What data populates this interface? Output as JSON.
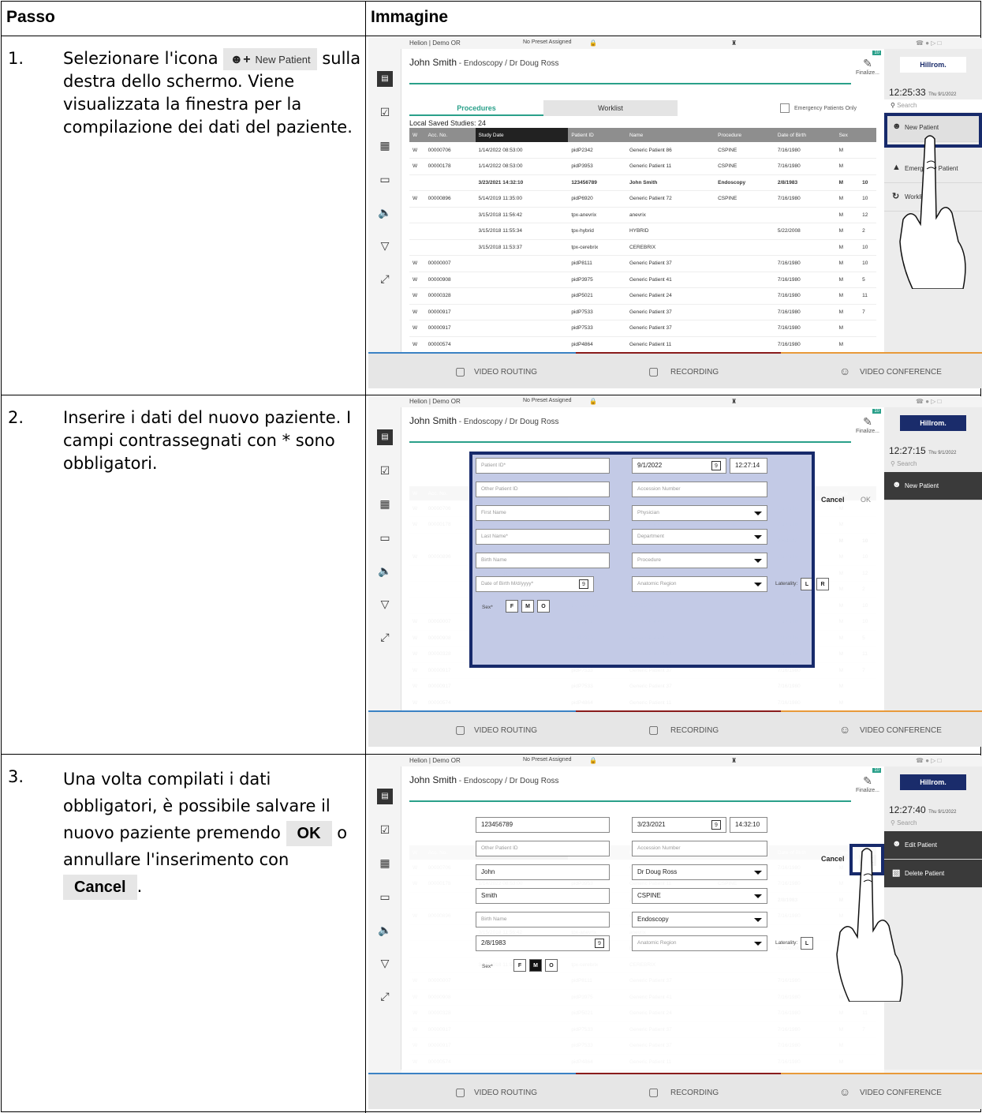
{
  "table": {
    "header_step": "Passo",
    "header_image": "Immagine"
  },
  "steps": [
    {
      "num": "1.",
      "text_a": "Selezionare l'icona",
      "icon_label": "New Patient",
      "text_b": "sulla destra dello schermo. Viene visualizzata la finestra per la compilazione dei dati del paziente."
    },
    {
      "num": "2.",
      "text": "Inserire i dati del nuovo paziente. I campi contrassegnati con * sono obbligatori."
    },
    {
      "num": "3.",
      "text_a": "Una volta compilati i dati obbligatori, è possibile salvare il nuovo paziente premendo",
      "ok": "OK",
      "text_b": "o annullare l'inserimento con",
      "cancel": "Cancel",
      "text_c": "."
    }
  ],
  "ui": {
    "room": "Helion | Demo OR",
    "preset": "No Preset Assigned",
    "patient_name": "John Smith",
    "patient_sub": " - Endoscopy / Dr Doug Ross",
    "finalize": "Finalize...",
    "badge": "10",
    "brand": "Hillrom.",
    "date": "Thu 9/1/2022",
    "search": "Search",
    "tab_procedures": "Procedures",
    "tab_worklist": "Worklist",
    "emergency_only": "Emergency Patients Only",
    "local_saved": "Local Saved Studies: 24",
    "columns": [
      "Acc. No.",
      "Study Date",
      "Patient ID",
      "Name",
      "Procedure",
      "Date of Birth",
      "Sex"
    ],
    "rows": [
      [
        "W",
        "00000706",
        "1/14/2022 08:53:00",
        "pidP2342",
        "Generic Patient 86",
        "CSPINE",
        "7/16/1980",
        "M",
        ""
      ],
      [
        "W",
        "00000178",
        "1/14/2022 08:53:00",
        "pidP3953",
        "Generic Patient 11",
        "CSPINE",
        "7/16/1980",
        "M",
        ""
      ],
      [
        "",
        "",
        "3/23/2021 14:32:10",
        "123456789",
        "John Smith",
        "Endoscopy",
        "2/8/1983",
        "M",
        "10"
      ],
      [
        "W",
        "00000896",
        "5/14/2019 11:35:00",
        "pidP6920",
        "Generic Patient 72",
        "CSPINE",
        "7/16/1980",
        "M",
        "10"
      ],
      [
        "",
        "",
        "3/15/2018 11:56:42",
        "tpx-anevrix",
        "anevrix",
        "",
        "",
        "M",
        "12"
      ],
      [
        "",
        "",
        "3/15/2018 11:55:34",
        "tpx-hybrid",
        "HYBRID",
        "",
        "5/22/2008",
        "M",
        "2"
      ],
      [
        "",
        "",
        "3/15/2018 11:53:37",
        "tpx-cerebrix",
        "CEREBRIX",
        "",
        "",
        "M",
        "10"
      ],
      [
        "W",
        "00000007",
        "",
        "pidP8111",
        "Generic Patient 37",
        "",
        "7/16/1980",
        "M",
        "10"
      ],
      [
        "W",
        "00000908",
        "",
        "pidP3975",
        "Generic Patient 41",
        "",
        "7/16/1980",
        "M",
        "5"
      ],
      [
        "W",
        "00000328",
        "",
        "pidP5021",
        "Generic Patient 24",
        "",
        "7/16/1980",
        "M",
        "11"
      ],
      [
        "W",
        "00000917",
        "",
        "pidP7533",
        "Generic Patient 37",
        "",
        "7/16/1980",
        "M",
        "7"
      ],
      [
        "W",
        "00000917",
        "",
        "pidP7533",
        "Generic Patient 37",
        "",
        "7/16/1980",
        "M",
        ""
      ],
      [
        "W",
        "00000574",
        "",
        "pidP4864",
        "Generic Patient 11",
        "",
        "7/16/1980",
        "M",
        ""
      ]
    ],
    "new_patient": "New Patient",
    "emergency_patient": "Emergency Patient",
    "worklist_item": "Worklist",
    "edit_patient": "Edit Patient",
    "delete_patient": "Delete Patient",
    "video_routing": "VIDEO ROUTING",
    "recording": "RECORDING",
    "video_conference": "VIDEO CONFERENCE",
    "cancel": "Cancel",
    "ok": "OK",
    "laterality": "Laterality:",
    "sex_label": "Sex*",
    "sex_f": "F",
    "sex_m": "M",
    "sex_o": "O",
    "lat_l": "L",
    "lat_r": "R"
  },
  "screens": [
    {
      "time": "12:25:33"
    },
    {
      "time": "12:27:15",
      "f": {
        "patient_id": "Patient ID*",
        "other_id": "Other Patient ID",
        "first": "First Name",
        "last": "Last Name*",
        "birth": "Birth Name",
        "dob": "Date of Birth M/d/yyyy*",
        "date": "9/1/2022",
        "time": "12:27:14",
        "acc": "Accession Number",
        "phys": "Physician",
        "dept": "Department",
        "proc": "Procedure",
        "anat": "Anatomic Region"
      }
    },
    {
      "time": "12:27:40",
      "f": {
        "patient_id": "123456789",
        "other_id": "Other Patient ID",
        "first": "John",
        "last": "Smith",
        "birth": "Birth Name",
        "dob": "2/8/1983",
        "date": "3/23/2021",
        "time": "14:32:10",
        "acc": "Accession Number",
        "phys": "Dr Doug Ross",
        "dept": "CSPINE",
        "proc": "Endoscopy",
        "anat": "Anatomic Region"
      }
    }
  ]
}
